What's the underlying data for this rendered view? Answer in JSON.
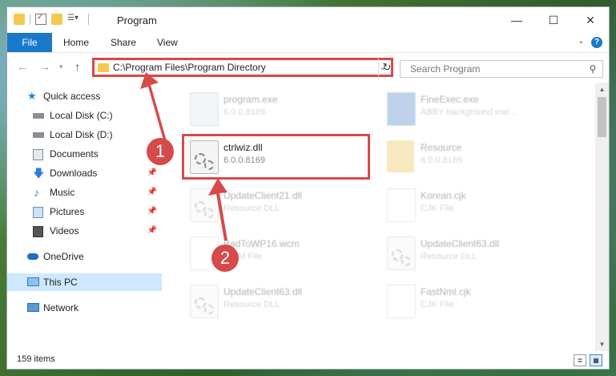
{
  "window": {
    "title": "Program"
  },
  "ribbon": {
    "tabs": [
      "File",
      "Home",
      "Share",
      "View"
    ],
    "help_icon": "help-icon"
  },
  "nav": {
    "address_path": "C:\\Program Files\\Program Directory",
    "search_placeholder": "Search Program"
  },
  "sidebar": {
    "items": [
      {
        "label": "Quick access",
        "icon": "star-icon"
      },
      {
        "label": "Local Disk (C:)",
        "icon": "drive-icon"
      },
      {
        "label": "Local Disk (D:)",
        "icon": "drive-icon"
      },
      {
        "label": "Documents",
        "icon": "documents-icon"
      },
      {
        "label": "Downloads",
        "icon": "download-icon"
      },
      {
        "label": "Music",
        "icon": "music-icon"
      },
      {
        "label": "Pictures",
        "icon": "pictures-icon"
      },
      {
        "label": "Videos",
        "icon": "videos-icon"
      },
      {
        "label": "OneDrive",
        "icon": "cloud-icon"
      },
      {
        "label": "This PC",
        "icon": "computer-icon"
      },
      {
        "label": "Network",
        "icon": "network-icon"
      }
    ]
  },
  "files": [
    {
      "name": "program.exe",
      "sub": "6.0.0.8169"
    },
    {
      "name": "FineExec.exe",
      "sub": "ABBY background exe..."
    },
    {
      "name": "ctrlwiz.dll",
      "sub": "6.0.0.8169"
    },
    {
      "name": "Resource",
      "sub": "6.0.0.8169"
    },
    {
      "name": "UpdateClient21.dll",
      "sub": "Resource DLL"
    },
    {
      "name": "Korean.cjk",
      "sub": "CJK File"
    },
    {
      "name": "BadToWP16.wcm",
      "sub": "WCM File"
    },
    {
      "name": "UpdateClient63.dll",
      "sub": "Resource DLL"
    },
    {
      "name": "UpdateClient63.dll",
      "sub": "Resource DLL"
    },
    {
      "name": "FastNml.cjk",
      "sub": "CJK File"
    }
  ],
  "status": {
    "count": "159 items"
  },
  "callouts": [
    "1",
    "2"
  ],
  "colors": {
    "accent": "#1979ca",
    "highlight": "#d74a4a",
    "selected": "#cde8ff"
  }
}
